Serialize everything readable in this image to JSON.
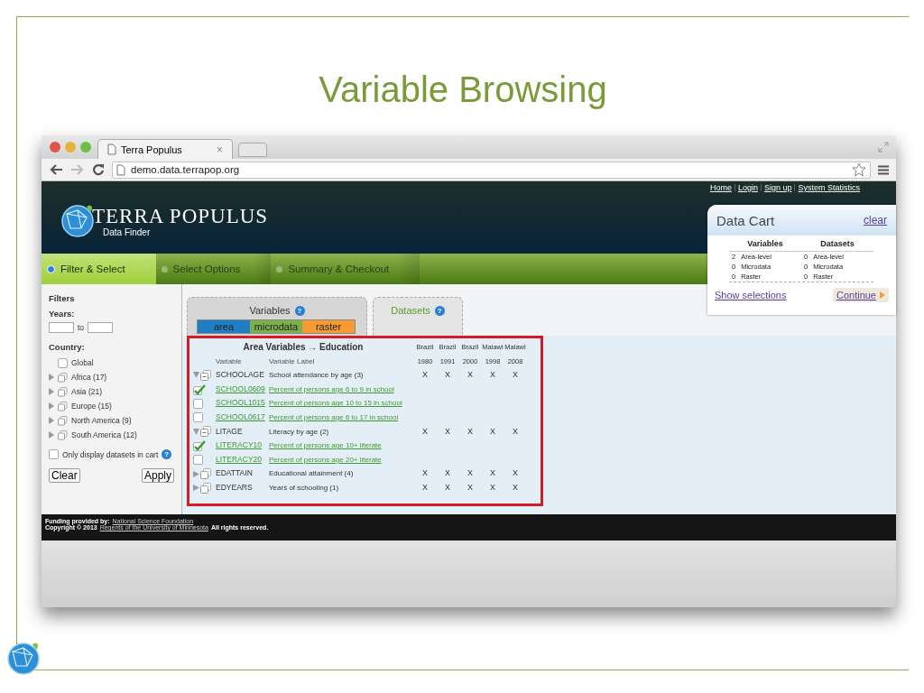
{
  "slide": {
    "title": "Variable Browsing"
  },
  "browser": {
    "tab_title": "Terra Populus",
    "tab_close": "×",
    "url": "demo.data.terrapop.org"
  },
  "header": {
    "links": [
      "Home",
      "Login",
      "Sign up",
      "System Statistics"
    ],
    "logo_title": "TERRA POPULUS",
    "logo_subtitle": "Data Finder"
  },
  "steps": [
    {
      "label": "Filter & Select",
      "selected": true
    },
    {
      "label": "Select Options",
      "selected": false
    },
    {
      "label": "Summary & Checkout",
      "selected": false
    }
  ],
  "data_cart": {
    "title": "Data Cart",
    "clear": "clear",
    "columns": [
      "Variables",
      "Datasets"
    ],
    "rows": [
      [
        {
          "count": "2",
          "label": "Area-level"
        },
        {
          "count": "0",
          "label": "Area-level"
        }
      ],
      [
        {
          "count": "0",
          "label": "Microdata"
        },
        {
          "count": "0",
          "label": "Microdata"
        }
      ],
      [
        {
          "count": "0",
          "label": "Raster"
        },
        {
          "count": "0",
          "label": "Raster"
        }
      ]
    ],
    "show_selections": "Show selections",
    "continue": "Continue"
  },
  "filters": {
    "title": "Filters",
    "years_label": "Years:",
    "to": "to",
    "country_label": "Country:",
    "countries": [
      {
        "kind": "checkbox",
        "label": "Global",
        "checked": false
      },
      {
        "kind": "group",
        "label": "Africa (17)"
      },
      {
        "kind": "group",
        "label": "Asia (21)"
      },
      {
        "kind": "group",
        "label": "Europe (15)"
      },
      {
        "kind": "group",
        "label": "North America (9)"
      },
      {
        "kind": "group",
        "label": "South America (12)"
      }
    ],
    "only_cart": {
      "label": "Only display datasets in cart",
      "checked": false,
      "help": "?"
    },
    "buttons": [
      "Clear",
      "Apply"
    ]
  },
  "tabs": [
    {
      "label": "Variables",
      "selected": true,
      "help": "?"
    },
    {
      "label": "Datasets",
      "selected": false,
      "help": "?"
    }
  ],
  "types": [
    {
      "label": "area",
      "color": "#1f7fc4"
    },
    {
      "label": "microdata",
      "color": "#7bb04a"
    },
    {
      "label": "raster",
      "color": "#f89a30"
    }
  ],
  "table": {
    "title": "Area Variables → Education",
    "columns": [
      "Variable",
      "Variable Label"
    ],
    "samples": [
      {
        "country": "Brazil",
        "year": "1980"
      },
      {
        "country": "Brazil",
        "year": "1991"
      },
      {
        "country": "Brazil",
        "year": "2000"
      },
      {
        "country": "Malawi",
        "year": "1998"
      },
      {
        "country": "Malawi",
        "year": "2008"
      }
    ],
    "rows": [
      {
        "kind": "group",
        "expanded": true,
        "variable": "SCHOOLAGE",
        "label": "School attendance by age (3)",
        "marks": [
          "X",
          "X",
          "X",
          "X",
          "X"
        ]
      },
      {
        "kind": "variable",
        "checked": true,
        "variable": "SCHOOL0609",
        "label": "Percent of persons age 6 to 9 in school"
      },
      {
        "kind": "variable",
        "checked": false,
        "variable": "SCHOOL1015",
        "label": "Percent of persons age 10 to 15 in school"
      },
      {
        "kind": "variable",
        "checked": false,
        "variable": "SCHOOL0617",
        "label": "Percent of persons age 6 to 17 in school"
      },
      {
        "kind": "group",
        "expanded": true,
        "variable": "LITAGE",
        "label": "Literacy by age (2)",
        "marks": [
          "X",
          "X",
          "X",
          "X",
          "X"
        ]
      },
      {
        "kind": "variable",
        "checked": true,
        "variable": "LITERACY10",
        "label": "Percent of persons age 10+ literate"
      },
      {
        "kind": "variable",
        "checked": false,
        "variable": "LITERACY20",
        "label": "Percent of persons age 20+ literate"
      },
      {
        "kind": "group",
        "expanded": false,
        "variable": "EDATTAIN",
        "label": "Educational attainment (4)",
        "marks": [
          "X",
          "X",
          "X",
          "X",
          "X"
        ]
      },
      {
        "kind": "group",
        "expanded": false,
        "variable": "EDYEARS",
        "label": "Years of schooling (1)",
        "marks": [
          "X",
          "X",
          "X",
          "X",
          "X"
        ]
      }
    ]
  },
  "footer": {
    "funding_label": "Funding provided by:",
    "funding_link": "National Science Foundation",
    "copyright": "Copyright © 2013",
    "copyright_link": "Regents of the University of Minnesota",
    "rights": "All rights reserved."
  }
}
